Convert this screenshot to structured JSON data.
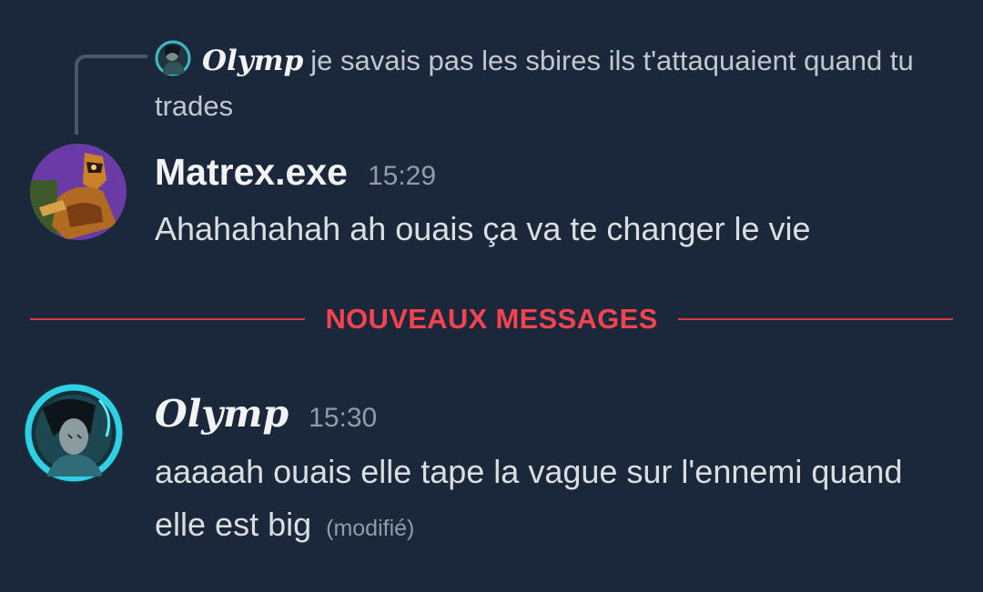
{
  "reply": {
    "author": "Olymp",
    "text": "je savais pas les sbires ils t'attaquaient quand tu trades"
  },
  "messages": [
    {
      "author": "Matrex.exe",
      "time": "15:29",
      "text": "Ahahahahah ah ouais ça va te changer le vie"
    },
    {
      "author": "Olymp",
      "time": "15:30",
      "text": "aaaaah ouais elle tape la vague sur l'ennemi quand elle est big",
      "edited_label": "(modifié)"
    }
  ],
  "divider": {
    "label": "NOUVEAUX MESSAGES"
  },
  "colors": {
    "background": "#1b283b",
    "new_messages_red": "#f2434f",
    "timestamp_gray": "#949ba4"
  }
}
